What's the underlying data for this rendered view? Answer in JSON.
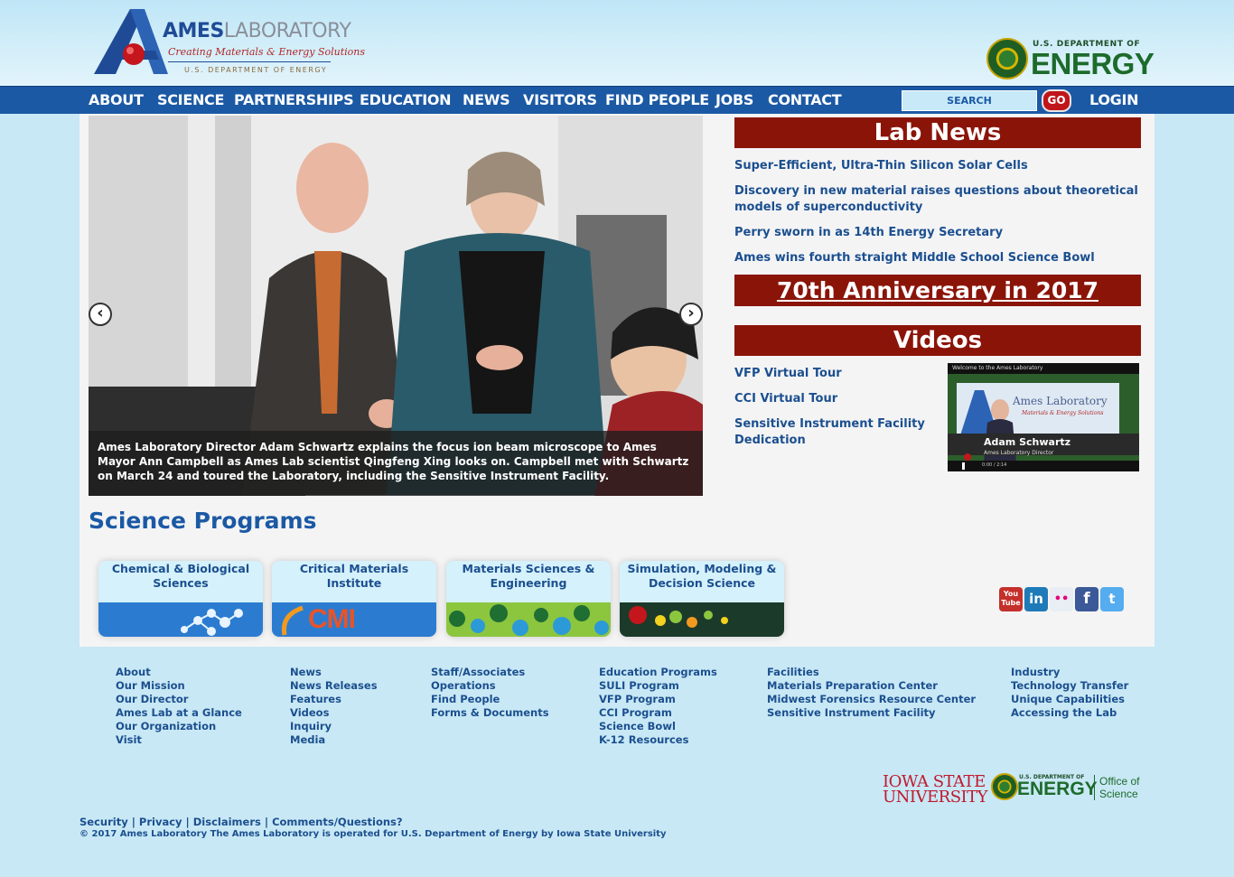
{
  "header": {
    "logo": {
      "name_part1": "AMES",
      "name_part2": "LABORATORY",
      "tagline": "Creating Materials & Energy Solutions",
      "sub": "U.S. DEPARTMENT OF ENERGY"
    },
    "doe": {
      "small": "U.S. DEPARTMENT OF",
      "big": "ENERGY"
    }
  },
  "nav": {
    "items": [
      "ABOUT",
      "SCIENCE",
      "PARTNERSHIPS",
      "EDUCATION",
      "NEWS",
      "VISITORS",
      "FIND PEOPLE",
      "JOBS",
      "CONTACT"
    ],
    "search_placeholder": "SEARCH",
    "go_label": "GO",
    "login_label": "LOGIN"
  },
  "slideshow": {
    "caption": "Ames Laboratory Director Adam Schwartz explains the focus ion beam microscope to Ames Mayor Ann Campbell as Ames Lab scientist Qingfeng Xing looks on. Campbell met with Schwartz on March 24 and toured the Laboratory, including the Sensitive Instrument Facility.",
    "prev_icon": "chevron-left-icon",
    "next_icon": "chevron-right-icon"
  },
  "lab_news": {
    "title": "Lab News",
    "items": [
      "Super-Efficient, Ultra-Thin Silicon Solar Cells",
      "Discovery in new material raises questions about theoretical models of superconductivity",
      "Perry sworn in as 14th Energy Secretary",
      "Ames wins fourth straight Middle School Science Bowl"
    ]
  },
  "anniversary": "70th Anniversary in 2017",
  "videos": {
    "title": "Videos",
    "items": [
      "VFP Virtual Tour",
      "CCI Virtual Tour",
      "Sensitive Instrument Facility Dedication"
    ],
    "thumb": {
      "header": "Welcome to the Ames Laboratory",
      "lab_name": "Ames Laboratory",
      "lab_tag": "Materials & Energy Solutions",
      "person": "Adam Schwartz",
      "role": "Ames Laboratory Director",
      "time": "0:00 / 2:14"
    }
  },
  "science_programs": {
    "title": "Science Programs",
    "items": [
      {
        "label": "Chemical & Biological Sciences"
      },
      {
        "label": "Critical Materials Institute",
        "img_text": "CMI"
      },
      {
        "label": "Materials Sciences & Engineering"
      },
      {
        "label": "Simulation, Modeling & Decision Science"
      }
    ]
  },
  "social": [
    {
      "icon": "youtube-icon",
      "text": "You Tube",
      "color": "#c4302b"
    },
    {
      "icon": "linkedin-icon",
      "text": "in",
      "color": "#1e7bb8"
    },
    {
      "icon": "flickr-icon",
      "text": "••",
      "color": "#e8eef3"
    },
    {
      "icon": "facebook-icon",
      "text": "f",
      "color": "#3b5998"
    },
    {
      "icon": "twitter-icon",
      "text": "t",
      "color": "#55acee"
    }
  ],
  "footer": {
    "columns": [
      [
        "About",
        "Our Mission",
        "Our Director",
        "Ames Lab at a Glance",
        "Our Organization",
        "Visit"
      ],
      [
        "News",
        "News Releases",
        "Features",
        "Videos",
        "Inquiry",
        "Media"
      ],
      [
        "Staff/Associates",
        "Operations",
        "Find People",
        "Forms & Documents"
      ],
      [
        "Education Programs",
        "SULI Program",
        "VFP Program",
        "CCI Program",
        "Science Bowl",
        "K-12 Resources"
      ],
      [
        "Facilities",
        "Materials Preparation Center",
        "Midwest Forensics Resource Center",
        "Sensitive Instrument Facility"
      ],
      [
        "Industry",
        "Technology Transfer",
        "Unique Capabilities",
        "Accessing the Lab"
      ]
    ],
    "isu": {
      "line1": "IOWA STATE",
      "line2": "UNIVERSITY"
    },
    "doe": {
      "small": "U.S. DEPARTMENT OF",
      "big": "ENERGY",
      "office1": "Office of",
      "office2": "Science"
    },
    "legal": [
      "Security",
      "Privacy",
      "Disclaimers",
      "Comments/Questions?"
    ],
    "copyright": "© 2017 Ames Laboratory The Ames Laboratory is operated for U.S. Department of Energy by Iowa State University"
  },
  "colors": {
    "nav_blue": "#1b59a4",
    "banner_red": "#8b1409",
    "link_blue": "#1b4f8f",
    "footer_bg": "#c8e8f5"
  }
}
